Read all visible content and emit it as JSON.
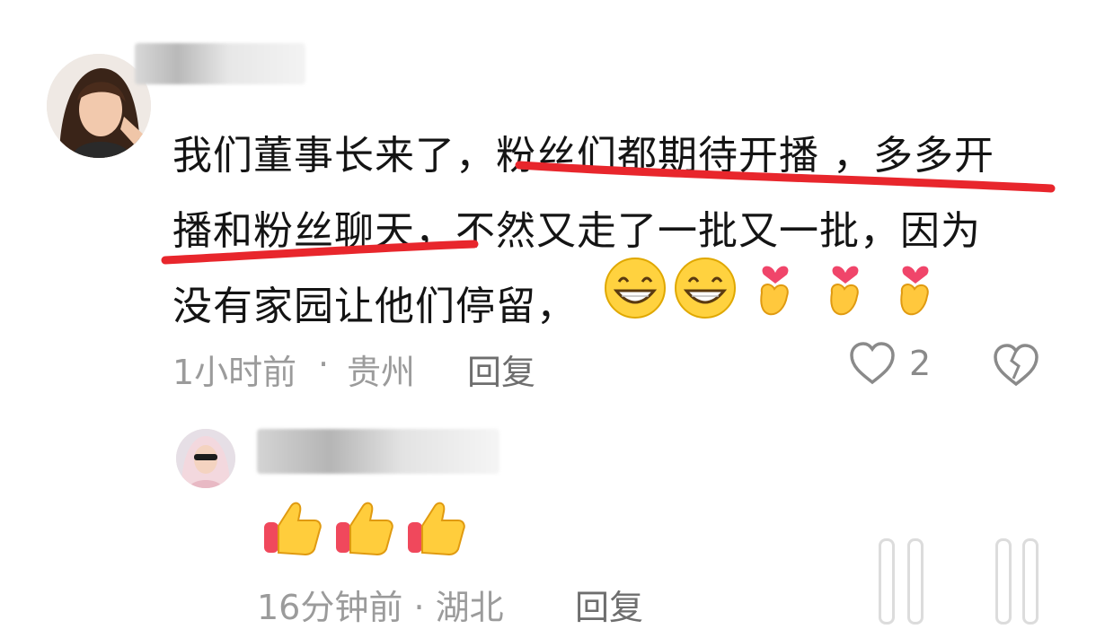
{
  "comment1": {
    "text_lines": [
      "我们董事长来了，粉丝们都期待开播 ，多多开",
      "播和粉丝聊天，不然又走了一批又一批，因为",
      "没有家园让他们停留，"
    ],
    "emojis": [
      "grin-icon",
      "grin-icon",
      "finger-heart-icon",
      "finger-heart-icon",
      "finger-heart-icon"
    ],
    "time": "1小时前",
    "separator": "·",
    "location": "贵州",
    "reply_label": "回复",
    "like_count": "2"
  },
  "comment2": {
    "emojis": [
      "thumbs-up-icon",
      "thumbs-up-icon",
      "thumbs-up-icon"
    ],
    "time": "16分钟前",
    "separator": "·",
    "location": "湖北",
    "reply_label": "回复"
  },
  "colors": {
    "underline": "#e8262c",
    "meta_text": "#9b9b9b",
    "body_text": "#141414"
  }
}
